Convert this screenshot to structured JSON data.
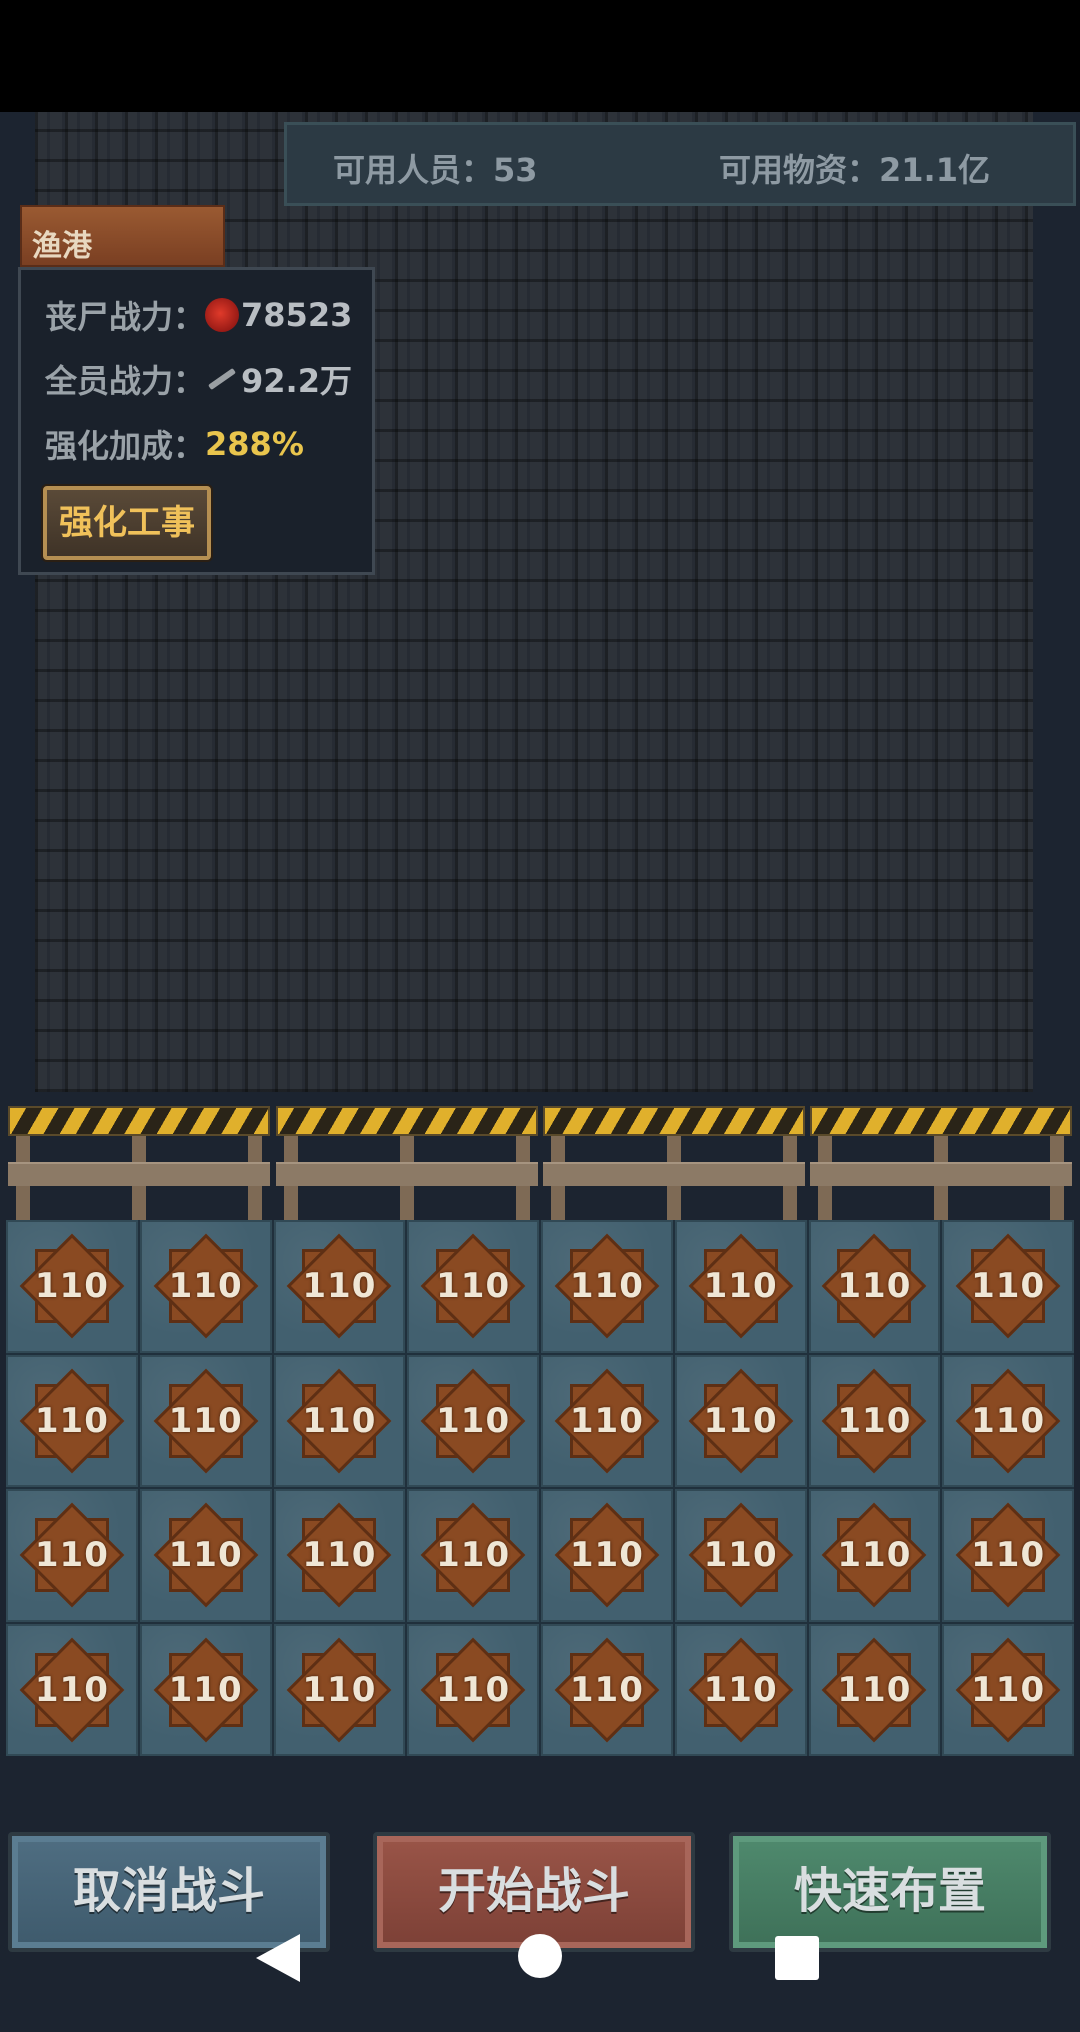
{
  "resources": {
    "personnel_label": "可用人员：53",
    "supplies_label": "可用物资：21.1亿"
  },
  "location": {
    "name": "渔港"
  },
  "stats": {
    "zombie_power_label": "丧尸战力：",
    "zombie_power_value": "78523",
    "team_power_label": "全员战力：",
    "team_power_value": "92.2万",
    "bonus_label": "强化加成：",
    "bonus_value": "288%",
    "upgrade_button": "强化工事"
  },
  "grid": {
    "rows": 4,
    "cols": 8,
    "cell_value": "110"
  },
  "actions": {
    "cancel": "取消战斗",
    "start": "开始战斗",
    "quick_deploy": "快速布置"
  },
  "colors": {
    "gold": "#e9c54d",
    "cancel_button": "#4f6e82",
    "start_button": "#9a5548",
    "quick_button": "#4f8a6e"
  }
}
